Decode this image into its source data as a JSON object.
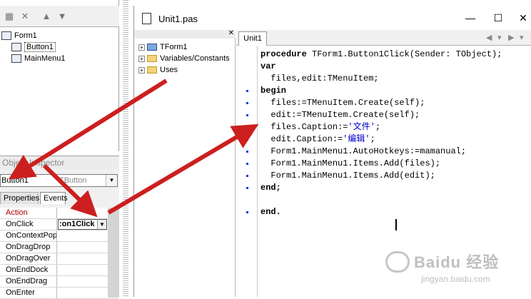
{
  "tree": {
    "items": [
      {
        "label": "Form1",
        "indent": 0
      },
      {
        "label": "Button1",
        "indent": 1
      },
      {
        "label": "MainMenu1",
        "indent": 1
      }
    ]
  },
  "inspector": {
    "title": "Object Inspector",
    "object_name": "Button1",
    "object_type": "TButton",
    "tabs": {
      "properties": "Properties",
      "events": "Events"
    },
    "category": "Action",
    "rows": [
      {
        "key": "OnClick",
        "value": ":on1Click"
      },
      {
        "key": "OnContextPopup",
        "value": ""
      },
      {
        "key": "OnDragDrop",
        "value": ""
      },
      {
        "key": "OnDragOver",
        "value": ""
      },
      {
        "key": "OnEndDock",
        "value": ""
      },
      {
        "key": "OnEndDrag",
        "value": ""
      },
      {
        "key": "OnEnter",
        "value": ""
      }
    ]
  },
  "editor": {
    "title": "Unit1.pas",
    "tab": "Unit1",
    "explorer": [
      {
        "label": "TForm1",
        "icon": "class-icon"
      },
      {
        "label": "Variables/Constants",
        "icon": "folder-icon"
      },
      {
        "label": "Uses",
        "icon": "folder-icon"
      }
    ],
    "code": [
      {
        "kw": "procedure",
        "rest": " TForm1.Button1Click(Sender: TObject);",
        "str": "",
        "tail": "",
        "dot": false
      },
      {
        "kw": "var",
        "rest": "",
        "str": "",
        "tail": "",
        "dot": false
      },
      {
        "kw": "",
        "rest": "  files,edit:TMenuItem;",
        "str": "",
        "tail": "",
        "dot": false
      },
      {
        "kw": "begin",
        "rest": "",
        "str": "",
        "tail": "",
        "dot": true
      },
      {
        "kw": "",
        "rest": "  files:=TMenuItem.Create(self);",
        "str": "",
        "tail": "",
        "dot": true
      },
      {
        "kw": "",
        "rest": "  edit:=TMenuItem.Create(self);",
        "str": "",
        "tail": "",
        "dot": true
      },
      {
        "kw": "",
        "rest": "  files.Caption:=",
        "str": "'文件'",
        "tail": ";",
        "dot": true
      },
      {
        "kw": "",
        "rest": "  edit.Caption:=",
        "str": "'编辑'",
        "tail": ";",
        "dot": true
      },
      {
        "kw": "",
        "rest": "  Form1.MainMenu1.AutoHotkeys:=mamanual;",
        "str": "",
        "tail": "",
        "dot": true
      },
      {
        "kw": "",
        "rest": "  Form1.MainMenu1.Items.Add(files);",
        "str": "",
        "tail": "",
        "dot": true
      },
      {
        "kw": "",
        "rest": "  Form1.MainMenu1.Items.Add(edit);",
        "str": "",
        "tail": "",
        "dot": true
      },
      {
        "kw": "end;",
        "rest": "",
        "str": "",
        "tail": "",
        "dot": true
      },
      {
        "kw": "",
        "rest": "",
        "str": "",
        "tail": "",
        "dot": false
      },
      {
        "kw": "end.",
        "rest": "",
        "str": "",
        "tail": "",
        "dot": true
      }
    ]
  },
  "watermark": {
    "text": "Baidu 经验",
    "url": "jingyan.baidu.com"
  },
  "colors": {
    "arrow": "#cc1f1f",
    "category_text": "#b00000",
    "string_text": "#0000c8",
    "breakpoint_dot": "#1a3fd0"
  }
}
